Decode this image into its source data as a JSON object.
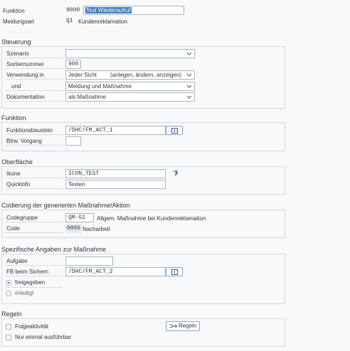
{
  "header": {
    "funktion_label": "Funktion",
    "funktion_value": "9000",
    "funktion_text": "Test Wiederaufruf",
    "meldungsart_label": "Meldungsart",
    "meldungsart_value": "Q1",
    "meldungsart_text": "Kundenreklamation"
  },
  "steuerung": {
    "title": "Steuerung",
    "szenario_label": "Szenario",
    "szenario_value": "",
    "sortiernummer_label": "Sortiernummer",
    "sortiernummer_value": "900",
    "verwendung_label": "Verwendung in",
    "verwendung_value": "Jeder Sicht",
    "verwendung_detail": "(anlegen, ändern, anzeigen)",
    "und_label": "und",
    "und_value": "Meldung und Maßnahme",
    "dokumentation_label": "Dokumentation",
    "dokumentation_value": "als Maßnahme"
  },
  "funktion": {
    "title": "Funktion",
    "baustein_label": "Funktionsbaustein",
    "baustein_value": "/DHC/FM_ACT_1",
    "btrw_label": "Btrw. Vorgang",
    "btrw_value": ""
  },
  "oberflaeche": {
    "title": "Oberfläche",
    "ikone_label": "Ikone",
    "ikone_value": "ICON_TEST",
    "quickinfo_label": "Quickinfo",
    "quickinfo_value": "Testen"
  },
  "codierung": {
    "title": "Codierung der generierten Maßnahme/Aktion",
    "codegruppe_label": "Codegruppe",
    "codegruppe_value": "QM-G1",
    "codegruppe_text": "Allgem. Maßnahme bei Kundenreklamation",
    "code_label": "Code",
    "code_value": "0006",
    "code_text": "Nacharbeit"
  },
  "spezifisch": {
    "title": "Spezifische Angaben zur Maßnahme",
    "aufgabe_label": "Aufgabe",
    "aufgabe_value": "",
    "fb_label": "FB beim Sichern",
    "fb_value": "/DHC/FM_ACT_2",
    "radio_freigegeben": "freigegeben",
    "radio_erledigt": "erledigt"
  },
  "regeln": {
    "title": "Regeln",
    "folgeaktivitaet": "Folgeaktivität",
    "nur_einmal": "Nur einmal ausführbar",
    "regeln_button": "Regeln"
  },
  "colors": {
    "accent": "#0a6ed1",
    "selection": "#3f7cc0",
    "icon_blue": "#2b5797"
  }
}
